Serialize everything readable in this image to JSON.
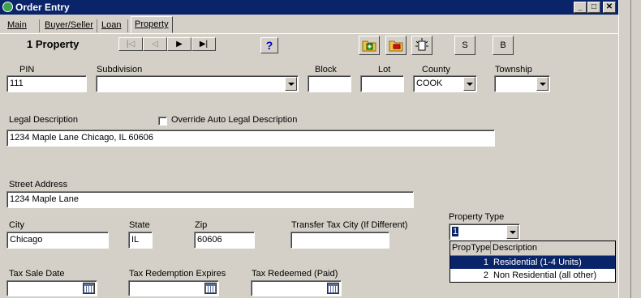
{
  "window": {
    "title": "Order Entry"
  },
  "tabs": [
    "Main",
    "Buyer/Seller",
    "Loan",
    "Property"
  ],
  "toolbar": {
    "record_label": "1 Property",
    "first_symbol": "|◁",
    "prev_symbol": "◁",
    "next_symbol": "▶",
    "last_symbol": "▶|",
    "help_symbol": "?",
    "s_label": "S",
    "b_label": "B"
  },
  "fields": {
    "pin": {
      "label": "PIN",
      "value": "111"
    },
    "subdivision": {
      "label": "Subdivision",
      "value": ""
    },
    "block": {
      "label": "Block",
      "value": ""
    },
    "lot": {
      "label": "Lot",
      "value": ""
    },
    "county": {
      "label": "County",
      "value": "COOK"
    },
    "township": {
      "label": "Township",
      "value": ""
    },
    "legal_description": {
      "label": "Legal Description",
      "value": "1234 Maple Lane Chicago,  IL 60606"
    },
    "override_legal": {
      "label": "Override Auto Legal Description",
      "checked": false
    },
    "street_address": {
      "label": "Street Address",
      "value": "1234 Maple Lane"
    },
    "city": {
      "label": "City",
      "value": "Chicago"
    },
    "state": {
      "label": "State",
      "value": "IL"
    },
    "zip": {
      "label": "Zip",
      "value": "60606"
    },
    "transfer_tax_city": {
      "label": "Transfer Tax City (If Different)",
      "value": ""
    },
    "property_type": {
      "label": "Property Type",
      "value": "1"
    },
    "tax_sale_date": {
      "label": "Tax Sale Date",
      "value": ""
    },
    "tax_redemption_expires": {
      "label": "Tax Redemption Expires",
      "value": ""
    },
    "tax_redeemed": {
      "label": "Tax Redeemed (Paid)",
      "value": ""
    }
  },
  "property_type_dropdown": {
    "headers": [
      "PropType",
      "Description"
    ],
    "rows": [
      {
        "code": "1",
        "description": "Residential (1-4 Units)",
        "selected": true
      },
      {
        "code": "2",
        "description": "Non Residential (all other)",
        "selected": false
      }
    ]
  },
  "colors": {
    "titlebar": "#0a246a",
    "selection": "#0a246a",
    "panel": "#d4d0c8"
  }
}
